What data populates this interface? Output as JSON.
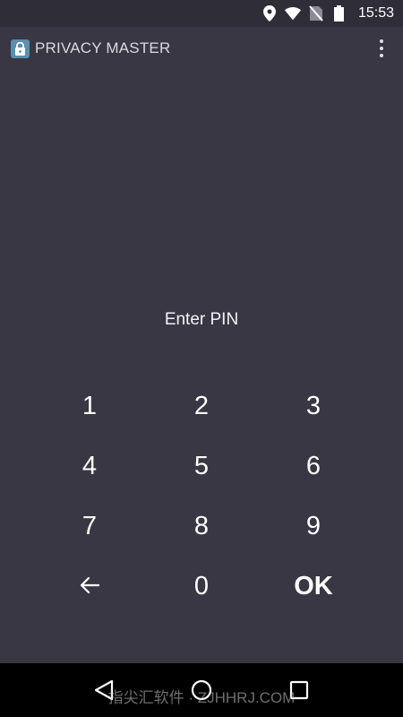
{
  "status_bar": {
    "time": "15:53",
    "icons": [
      "location-icon",
      "wifi-icon",
      "no-sim-icon",
      "battery-icon"
    ]
  },
  "app_bar": {
    "title": "PRIVACY MASTER",
    "logo_icon": "lock-icon",
    "menu_icon": "more-vertical-icon"
  },
  "prompt": "Enter PIN",
  "keypad": {
    "keys": [
      "1",
      "2",
      "3",
      "4",
      "5",
      "6",
      "7",
      "8",
      "9",
      "0"
    ],
    "back_icon": "arrow-left-icon",
    "ok_label": "OK"
  },
  "nav_bar": {
    "icons": [
      "back-triangle-icon",
      "home-circle-icon",
      "recents-square-icon"
    ]
  },
  "watermark": "指尖汇软件 · ZJHHRJ.COM",
  "colors": {
    "background": "#3a3744",
    "status_bar": "#2f2d37",
    "nav_bar": "#000000",
    "logo_accent": "#5a8fae"
  }
}
